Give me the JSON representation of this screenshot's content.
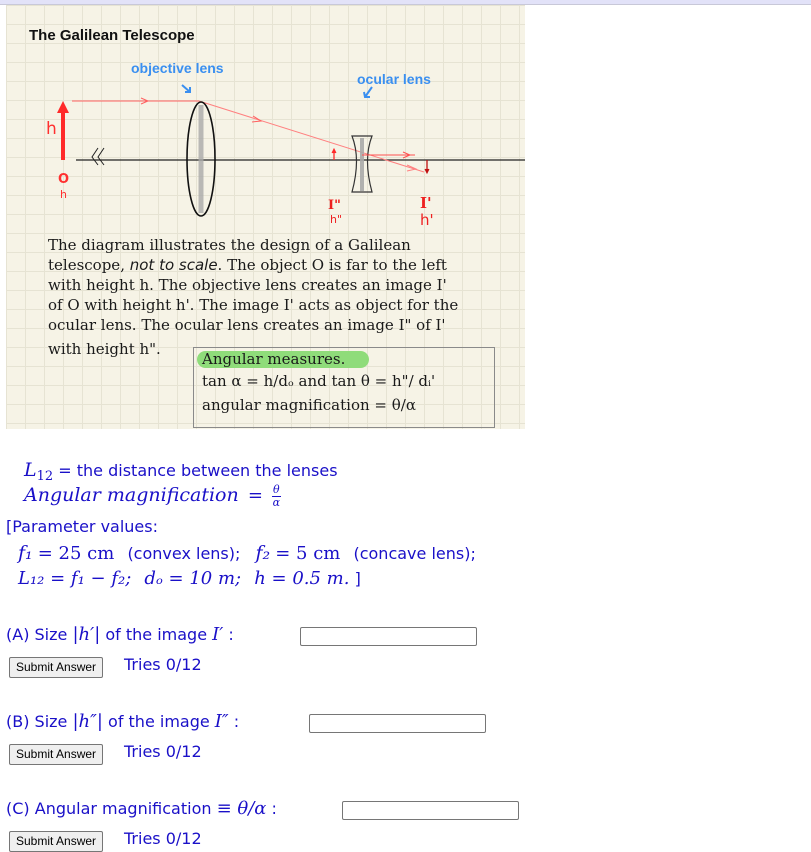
{
  "figure": {
    "title": "The Galilean Telescope",
    "objective_label": "objective lens",
    "ocular_label": "ocular lens",
    "object_height_label": "h",
    "object_label": "O",
    "object_sub_label": "h",
    "image2_label": "I\"",
    "image2_height_label": "h\"",
    "image1_label": "I'",
    "image1_height_label": "h'",
    "description_lines": [
      "The diagram illustrates the design of a Galilean",
      "telescope, ",
      "with height h. The objective lens creates an image I'",
      "of O with height h'.  The image I' acts as object for the",
      "ocular lens. The ocular lens creates an image I\" of I'",
      "with height h\"."
    ],
    "description_italic": "not to scale",
    "description_line2_rest": ". The object O is far to the left",
    "angular_box": {
      "title": "Angular measures.",
      "line1": "tan α = h/dₒ   and    tan θ  =  h\"/ dᵢ'",
      "line2": "angular magnification = θ/α"
    },
    "colors": {
      "ray": "#ff4a4a",
      "label_blue": "#3a8ff0",
      "highlight": "#8fdc7a",
      "paper": "#f6f3e6"
    }
  },
  "definitions": {
    "l12_symbol": "L",
    "l12_sub": "12",
    "l12_text": "= the distance between the lenses",
    "angmag_text": "Angular magnification",
    "angmag_eq": "=",
    "angmag_num": "θ",
    "angmag_den": "α"
  },
  "parameters": {
    "header": "[Parameter values:",
    "line1": {
      "f1_sym": "f₁",
      "f1_val": "= 25 cm",
      "f1_note": "(convex lens);",
      "f2_sym": "f₂",
      "f2_val": "= 5 cm",
      "f2_note": "(concave lens);"
    },
    "line2": {
      "l12": "L₁₂ = f₁ − f₂;",
      "do": "dₒ = 10 m;",
      "h": "h = 0.5 m.",
      "close": "]"
    }
  },
  "questions": [
    {
      "label_prefix": "(A) Size ",
      "label_math": "|h′|",
      "label_mid": " of the image ",
      "label_math2": "I′",
      "label_suffix": " :",
      "input_value": "",
      "submit_label": "Submit Answer",
      "tries": "Tries 0/12"
    },
    {
      "label_prefix": "(B) Size ",
      "label_math": "|h″|",
      "label_mid": " of the image ",
      "label_math2": "I″",
      "label_suffix": " :",
      "input_value": "",
      "submit_label": "Submit Answer",
      "tries": "Tries 0/12"
    },
    {
      "label_prefix": "(C) Angular magnification ",
      "label_math": "≡ θ/α",
      "label_mid": "",
      "label_math2": "",
      "label_suffix": " :",
      "input_value": "",
      "submit_label": "Submit Answer",
      "tries": "Tries 0/12"
    }
  ]
}
